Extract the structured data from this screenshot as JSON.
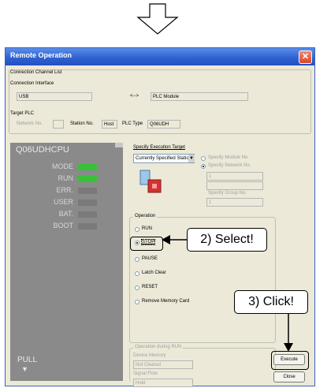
{
  "window": {
    "title": "Remote Operation",
    "close_glyph": "✕"
  },
  "connection": {
    "group_label": "Connection Channel List",
    "interface_label": "Connection Interface",
    "interface_value": "USB",
    "arrow_text": "<-->",
    "module_value": "PLC Module"
  },
  "target": {
    "label": "Target PLC",
    "network_label": "Network No.",
    "station_label": "Station No.",
    "station_value": "Host",
    "plc_type_label": "PLC Type",
    "plc_type_value": "Q06UDH"
  },
  "cpu": {
    "model": "Q06UDHCPU",
    "leds": [
      {
        "label": "MODE",
        "color": "#38c038"
      },
      {
        "label": "RUN",
        "color": "#38c038"
      },
      {
        "label": "ERR.",
        "color": "#7a7a7a"
      },
      {
        "label": "USER",
        "color": "#7a7a7a"
      },
      {
        "label": "BAT.",
        "color": "#7a7a7a"
      },
      {
        "label": "BOOT",
        "color": "#7a7a7a"
      }
    ],
    "pull_label": "PULL",
    "pull_arrow": "▼"
  },
  "exec_target": {
    "label": "Specify Execution Target",
    "selected": "Currently Specified Station",
    "module_no_label": "Specify Module No.",
    "network_no_label": "Specify Network No.",
    "network_value": "1",
    "group_no_label": "Specify Group No.",
    "group_value": "1"
  },
  "operation": {
    "label": "Operation",
    "options": [
      "RUN",
      "STOP",
      "PAUSE",
      "Latch Clear",
      "RESET",
      "Remove Memory Card"
    ],
    "selected": "STOP"
  },
  "during_run": {
    "label": "Operation during RUN",
    "device_memory_label": "Device Memory",
    "device_memory_value": "Not Cleared",
    "signal_flow_label": "Signal Flow",
    "signal_flow_value": "Hold"
  },
  "buttons": {
    "execute": "Execute",
    "close": "Close"
  },
  "callouts": {
    "select": "2) Select!",
    "click": "3) Click!"
  },
  "colors": {
    "title_bar": "#2d5fd0",
    "window_bg": "#ece9d8",
    "led_on": "#38c038"
  }
}
